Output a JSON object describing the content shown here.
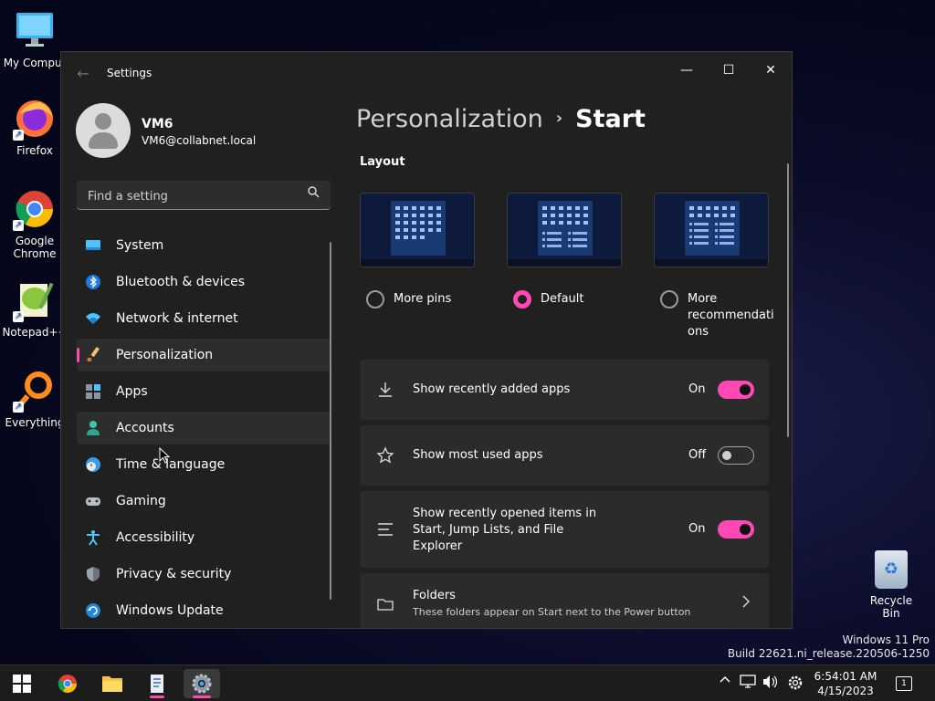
{
  "desktop": {
    "icons": [
      {
        "label": "My Comput"
      },
      {
        "label": "Firefox"
      },
      {
        "label": "Google\nChrome"
      },
      {
        "label": "Notepad++"
      },
      {
        "label": "Everything"
      }
    ],
    "recycle_bin": "Recycle Bin",
    "watermark": {
      "line1": "Windows 11 Pro",
      "line2": "Build 22621.ni_release.220506-1250"
    }
  },
  "window": {
    "title": "Settings",
    "back_glyph": "←",
    "controls": {
      "minimize": "—",
      "maximize": "☐",
      "close": "✕"
    }
  },
  "profile": {
    "name": "VM6",
    "email": "VM6@collabnet.local"
  },
  "search": {
    "placeholder": "Find a setting",
    "value": ""
  },
  "nav": {
    "items": [
      {
        "label": "System",
        "icon": "monitor-icon"
      },
      {
        "label": "Bluetooth & devices",
        "icon": "bluetooth-icon"
      },
      {
        "label": "Network & internet",
        "icon": "wifi-icon"
      },
      {
        "label": "Personalization",
        "icon": "brush-icon",
        "selected": true
      },
      {
        "label": "Apps",
        "icon": "apps-icon"
      },
      {
        "label": "Accounts",
        "icon": "person-icon"
      },
      {
        "label": "Time & language",
        "icon": "clock-globe-icon"
      },
      {
        "label": "Gaming",
        "icon": "gamepad-icon"
      },
      {
        "label": "Accessibility",
        "icon": "accessibility-icon"
      },
      {
        "label": "Privacy & security",
        "icon": "shield-icon"
      },
      {
        "label": "Windows Update",
        "icon": "update-icon"
      }
    ]
  },
  "breadcrumb": {
    "parent": "Personalization",
    "separator": "›",
    "current": "Start"
  },
  "layout": {
    "label": "Layout",
    "options": [
      {
        "label": "More pins",
        "selected": false
      },
      {
        "label": "Default",
        "selected": true
      },
      {
        "label": "More\nrecommendati\nons",
        "selected": false
      }
    ]
  },
  "settings": {
    "recent_apps": {
      "label": "Show recently added apps",
      "state": "On",
      "on": true
    },
    "most_used": {
      "label": "Show most used apps",
      "state": "Off",
      "on": false
    },
    "recent_items": {
      "label": "Show recently opened items in\nStart, Jump Lists, and File\nExplorer",
      "state": "On",
      "on": true
    },
    "folders": {
      "label": "Folders",
      "description": "These folders appear on Start next to the Power button"
    }
  },
  "taskbar": {
    "time": "6:54:01 AM",
    "date": "4/15/2023",
    "notification_count": "1"
  },
  "colors": {
    "accent": "#ff47b5",
    "window_bg": "#202020",
    "card_bg": "#2b2b2b"
  }
}
